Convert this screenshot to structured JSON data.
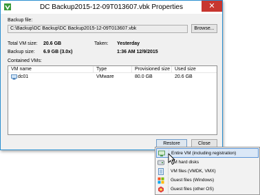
{
  "window": {
    "title": "DC Backup2015-12-09T013607.vbk Properties",
    "close_glyph": "✕"
  },
  "backup_file": {
    "label": "Backup file:",
    "path": "C:\\Backup\\DC Backup\\DC Backup2015-12-09T013607.vbk",
    "browse_label": "Browse..."
  },
  "stats": {
    "total_vm_size_label": "Total VM size:",
    "total_vm_size_value": "20.6 GB",
    "backup_size_label": "Backup size:",
    "backup_size_value": "6.9 GB (3.0x)",
    "taken_label": "Taken:",
    "taken_value": "Yesterday",
    "taken_time": "1:36 AM 12/9/2015"
  },
  "vms": {
    "label": "Contained VMs:",
    "columns": [
      "VM name",
      "Type",
      "Provisioned size",
      "Used size"
    ],
    "rows": [
      {
        "name": "dc01",
        "type": "VMware",
        "provisioned": "80.0 GB",
        "used": "20.6 GB"
      }
    ]
  },
  "buttons": {
    "restore": "Restore",
    "close": "Close"
  },
  "restore_menu": {
    "items": [
      {
        "label": "Entire VM (including registration)",
        "icon": "vm-restore-icon"
      },
      {
        "label": "VM hard disks",
        "icon": "hard-disk-icon"
      },
      {
        "label": "VM files (VMDK, VMX)",
        "icon": "vm-files-icon"
      },
      {
        "label": "Guest files (Windows)",
        "icon": "windows-logo-icon"
      },
      {
        "label": "Guest files (other OS)",
        "icon": "other-os-icon"
      }
    ]
  },
  "colors": {
    "title_close_bg": "#c7362f",
    "menu_hover_bg": "#dbe8f7",
    "menu_hover_border": "#5b94d6",
    "window_border": "#2a8fd0"
  }
}
